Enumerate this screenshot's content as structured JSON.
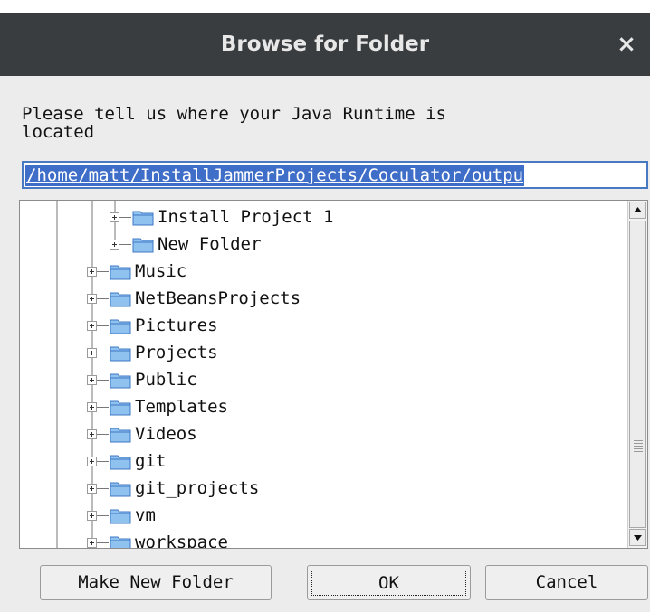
{
  "dialog": {
    "title": "Browse for Folder",
    "close_glyph": "×",
    "prompt": "Please tell us where your Java Runtime is\nlocated",
    "path_value": "/home/matt/InstallJammerProjects/Coculator/outpu"
  },
  "tree": {
    "items": [
      {
        "label": "Install Project 1",
        "level": 2
      },
      {
        "label": "New Folder",
        "level": 2
      },
      {
        "label": "Music",
        "level": 1
      },
      {
        "label": "NetBeansProjects",
        "level": 1
      },
      {
        "label": "Pictures",
        "level": 1
      },
      {
        "label": "Projects",
        "level": 1
      },
      {
        "label": "Public",
        "level": 1
      },
      {
        "label": "Templates",
        "level": 1
      },
      {
        "label": "Videos",
        "level": 1
      },
      {
        "label": "git",
        "level": 1
      },
      {
        "label": "git_projects",
        "level": 1
      },
      {
        "label": "vm",
        "level": 1
      },
      {
        "label": "workspace",
        "level": 1
      }
    ]
  },
  "buttons": {
    "make_new_folder": "Make New Folder",
    "ok": "OK",
    "cancel": "Cancel"
  },
  "colors": {
    "titlebar": "#393d3f",
    "selection": "#3f6ec8",
    "folder_fill": "#8fc2ee",
    "folder_stroke": "#3d77c5"
  }
}
